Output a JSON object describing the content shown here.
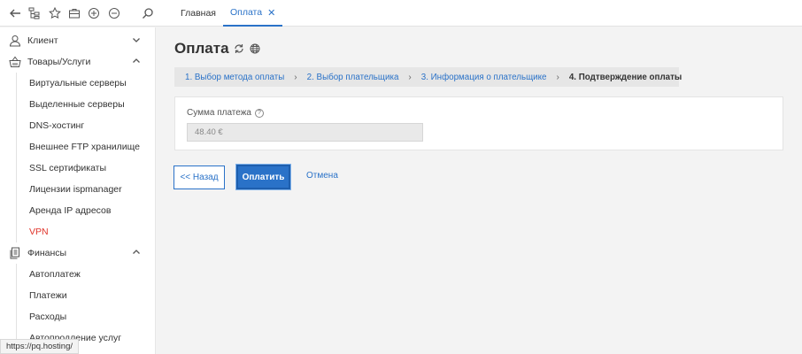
{
  "topbar": {
    "icons": [
      "back-arrow-icon",
      "sitemap-icon",
      "star-icon",
      "briefcase-icon",
      "plus-circle-icon",
      "minus-circle-icon",
      "search-icon"
    ],
    "tabs": [
      {
        "label": "Главная",
        "active": false
      },
      {
        "label": "Оплата",
        "active": true,
        "close": "✕"
      }
    ]
  },
  "sidebar": {
    "groups": [
      {
        "label": "Клиент",
        "icon": "user-icon",
        "expanded": false,
        "items": []
      },
      {
        "label": "Товары/Услуги",
        "icon": "basket-icon",
        "expanded": true,
        "items": [
          "Виртуальные серверы",
          "Выделенные серверы",
          "DNS-хостинг",
          "Внешнее FTP хранилище",
          "SSL сертификаты",
          "Лицензии ispmanager",
          "Аренда IP адресов",
          "VPN"
        ]
      },
      {
        "label": "Финансы",
        "icon": "documents-icon",
        "expanded": true,
        "items": [
          "Автоплатеж",
          "Платежи",
          "Расходы",
          "Автопродление услуг"
        ]
      }
    ],
    "highlight_color": "#e0342a"
  },
  "status_url": "https://pq.hosting/",
  "page": {
    "title": "Оплата",
    "steps": [
      "1. Выбор метода оплаты",
      "2. Выбор плательщика",
      "3. Информация о плательщике",
      "4. Подтверждение оплаты"
    ],
    "step_separator": "›",
    "current_step_index": 3,
    "field": {
      "label": "Сумма платежа",
      "help": "?",
      "value": "48.40 €"
    },
    "buttons": {
      "back": "<< Назад",
      "pay": "Оплатить",
      "cancel": "Отмена"
    }
  },
  "colors": {
    "accent": "#2a72c8",
    "background": "#f3f3f3"
  }
}
